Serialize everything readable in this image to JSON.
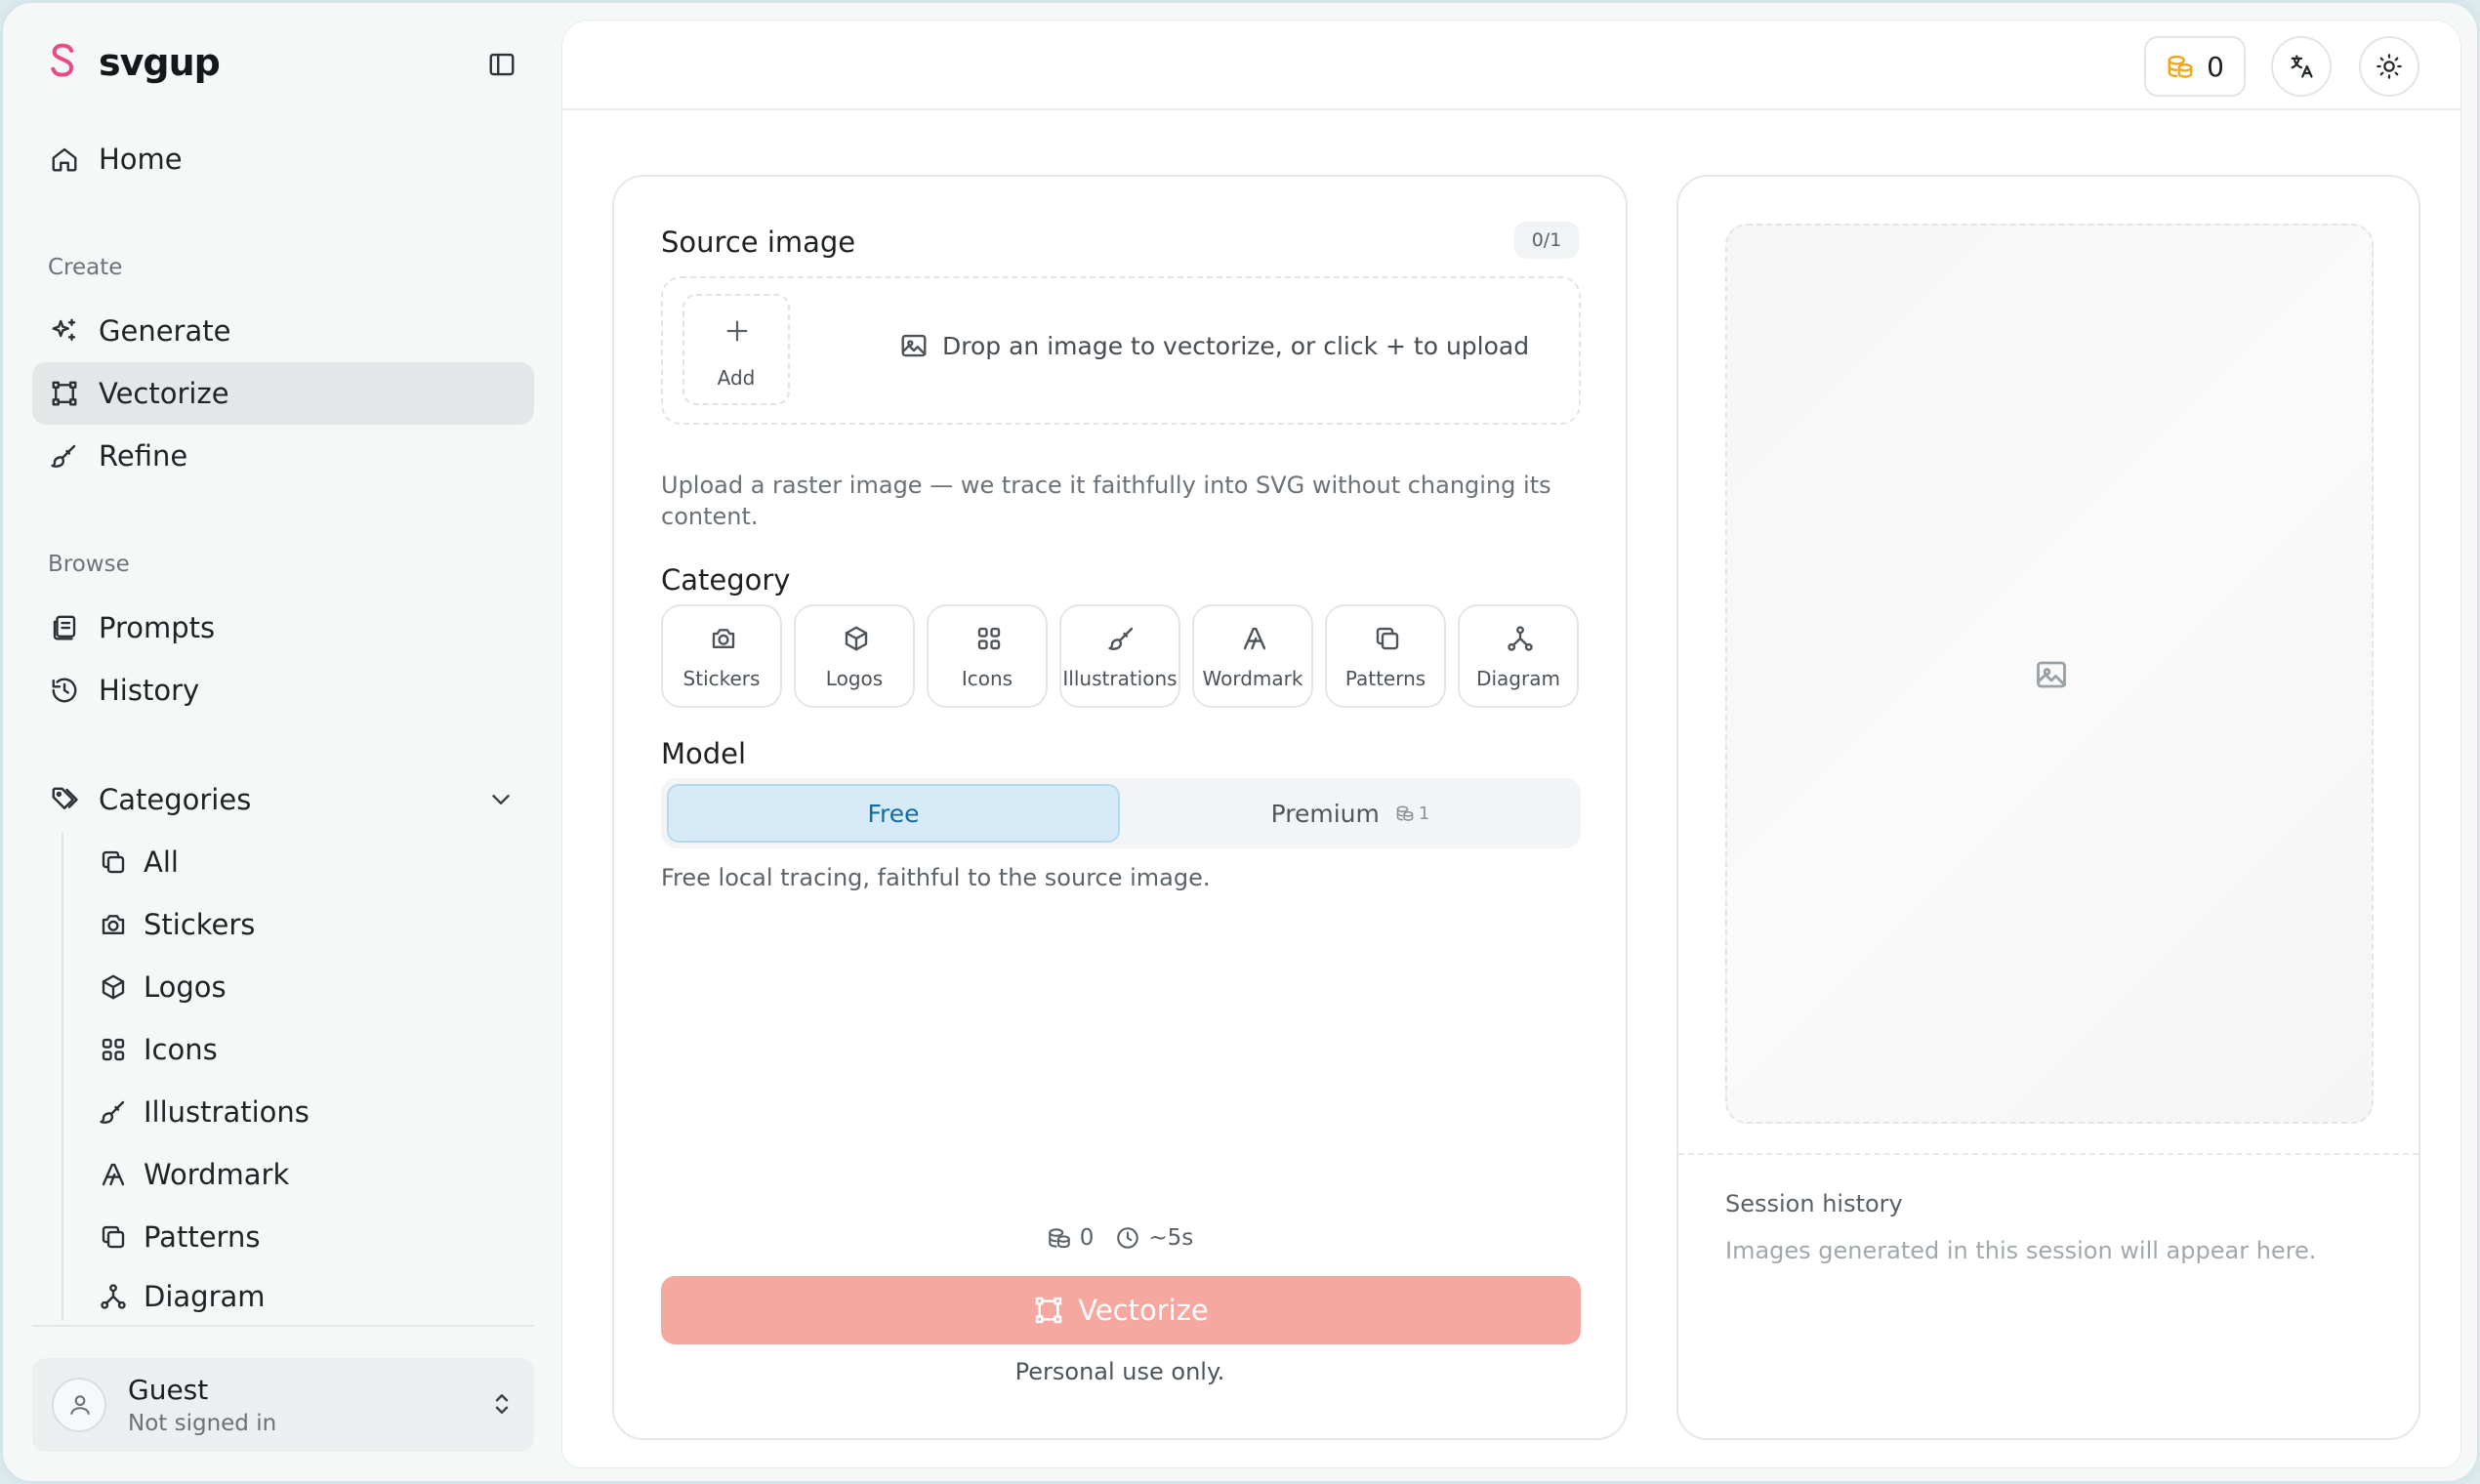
{
  "brand": {
    "name": "svgup",
    "accent_color": "#e84a86"
  },
  "sidebar": {
    "nav_main": [
      {
        "label": "Home",
        "icon": "home-icon"
      }
    ],
    "create_section": "Create",
    "create_items": [
      {
        "label": "Generate",
        "icon": "sparkles-icon"
      },
      {
        "label": "Vectorize",
        "icon": "vector-square-icon",
        "active": true
      },
      {
        "label": "Refine",
        "icon": "brush-icon"
      }
    ],
    "browse_section": "Browse",
    "browse_items": [
      {
        "label": "Prompts",
        "icon": "book-icon"
      },
      {
        "label": "History",
        "icon": "history-icon"
      }
    ],
    "categories_label": "Categories",
    "category_items": [
      {
        "label": "All",
        "icon": "layers-icon"
      },
      {
        "label": "Stickers",
        "icon": "camera-icon"
      },
      {
        "label": "Logos",
        "icon": "box-icon"
      },
      {
        "label": "Icons",
        "icon": "grid-icon"
      },
      {
        "label": "Illustrations",
        "icon": "brush-icon"
      },
      {
        "label": "Wordmark",
        "icon": "type-a-icon"
      },
      {
        "label": "Patterns",
        "icon": "layers-icon"
      },
      {
        "label": "Diagram",
        "icon": "network-icon"
      }
    ],
    "user": {
      "name": "Guest",
      "status": "Not signed in"
    }
  },
  "topbar": {
    "credits": "0"
  },
  "source": {
    "title": "Source image",
    "counter": "0/1",
    "add_label": "Add",
    "drop_hint": "Drop an image to vectorize, or click + to upload",
    "description": "Upload a raster image — we trace it faithfully into SVG without changing its content."
  },
  "category": {
    "title": "Category",
    "tiles": [
      {
        "label": "Stickers",
        "icon": "camera-icon"
      },
      {
        "label": "Logos",
        "icon": "box-icon"
      },
      {
        "label": "Icons",
        "icon": "grid-icon"
      },
      {
        "label": "Illustrations",
        "icon": "brush-icon"
      },
      {
        "label": "Wordmark",
        "icon": "type-a-icon"
      },
      {
        "label": "Patterns",
        "icon": "layers-icon"
      },
      {
        "label": "Diagram",
        "icon": "network-icon"
      }
    ]
  },
  "model": {
    "title": "Model",
    "free_label": "Free",
    "premium_label": "Premium",
    "premium_cost": "1",
    "selected": "Free",
    "note": "Free local tracing, faithful to the source image."
  },
  "action": {
    "cost": "0",
    "eta": "~5s",
    "button_label": "Vectorize",
    "button_color": "#f6a79f",
    "disclaimer": "Personal use only."
  },
  "session": {
    "title": "Session history",
    "empty_text": "Images generated in this session will appear here."
  }
}
